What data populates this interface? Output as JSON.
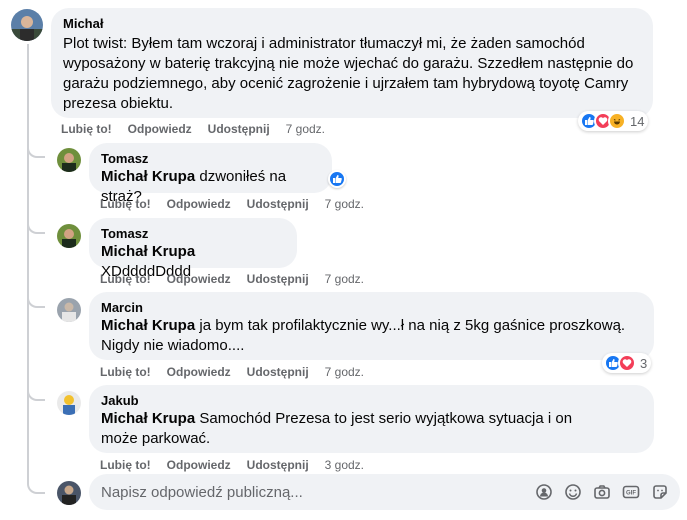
{
  "main_comment": {
    "author": "Michał",
    "text": "Plot twist: Byłem tam wczoraj i administrator tłumaczył mi, że żaden samochód wyposażony w baterię trakcyjną nie może wjechać do garażu. Szzedłem następnie do garażu podziemnego, aby ocenić zagrożenie i ujrzałem tam hybrydową toyotę Camry prezesa obiektu.",
    "actions": {
      "like": "Lubię to!",
      "reply": "Odpowiedz",
      "share": "Udostępnij",
      "time": "7 godz."
    },
    "reactions": {
      "count": "14",
      "types": [
        "like-icon",
        "love-icon",
        "haha-icon"
      ]
    }
  },
  "replies": [
    {
      "author": "Tomasz",
      "mention": "Michał Krupa",
      "text": " dzwoniłeś na straż?",
      "actions": {
        "like": "Lubię to!",
        "reply": "Odpowiedz",
        "share": "Udostępnij",
        "time": "7 godz."
      }
    },
    {
      "author": "Tomasz",
      "mention": "Michał Krupa",
      "text": " XDddddDddd",
      "actions": {
        "like": "Lubię to!",
        "reply": "Odpowiedz",
        "share": "Udostępnij",
        "time": "7 godz."
      }
    },
    {
      "author": "Marcin",
      "mention": "Michał Krupa",
      "text": " ja bym tak profilaktycznie wy...ł na nią z 5kg gaśnice proszkową. Nigdy nie wiadomo....",
      "actions": {
        "like": "Lubię to!",
        "reply": "Odpowiedz",
        "share": "Udostępnij",
        "time": "7 godz."
      },
      "reactions": {
        "count": "3",
        "types": [
          "like-icon",
          "love-icon"
        ]
      }
    },
    {
      "author": "Jakub",
      "mention": "Michał Krupa",
      "text": " Samochód Prezesa to jest serio wyjątkowa sytuacja i on może parkować.",
      "actions": {
        "like": "Lubię to!",
        "reply": "Odpowiedz",
        "share": "Udostępnij",
        "time": "3 godz."
      }
    }
  ],
  "reply_box": {
    "placeholder": "Napisz odpowiedź publiczną..."
  },
  "colors": {
    "like_blue": "#1877f2",
    "love_red": "#f33e58",
    "haha_yellow": "#f7b125",
    "bubble_bg": "#f0f2f5",
    "meta_gray": "#65676b"
  }
}
